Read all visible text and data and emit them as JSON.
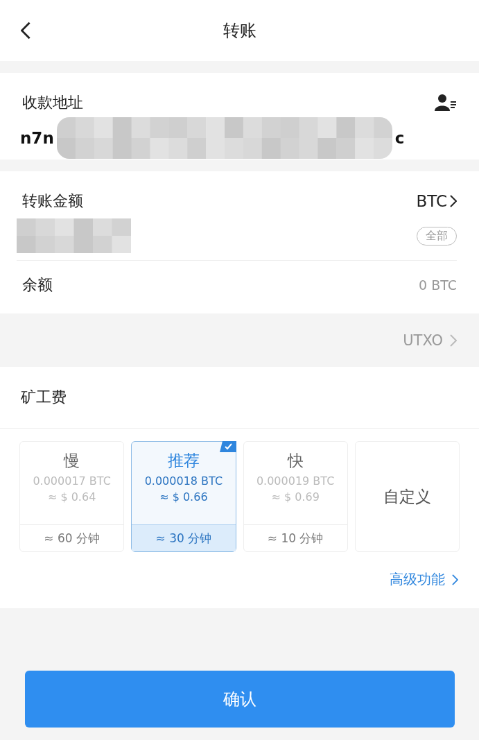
{
  "header": {
    "title": "转账"
  },
  "recipient": {
    "label": "收款地址",
    "address_start": "n7n",
    "address_end": "c"
  },
  "amount": {
    "label": "转账金额",
    "currency": "BTC",
    "all_button": "全部",
    "balance_label": "余额",
    "balance": "0 BTC"
  },
  "utxo": {
    "label": "UTXO"
  },
  "fee": {
    "title": "矿工费",
    "options": [
      {
        "kind": "preset",
        "label": "慢",
        "btc": "0.000017 BTC",
        "usd": "≈ $ 0.64",
        "time": "≈ 60 分钟",
        "selected": false
      },
      {
        "kind": "preset",
        "label": "推荐",
        "btc": "0.000018 BTC",
        "usd": "≈ $ 0.66",
        "time": "≈ 30 分钟",
        "selected": true
      },
      {
        "kind": "preset",
        "label": "快",
        "btc": "0.000019 BTC",
        "usd": "≈ $ 0.69",
        "time": "≈ 10 分钟",
        "selected": false
      },
      {
        "kind": "custom",
        "label": "自定义",
        "selected": false
      }
    ],
    "advanced": "高级功能"
  },
  "confirm": "确认"
}
